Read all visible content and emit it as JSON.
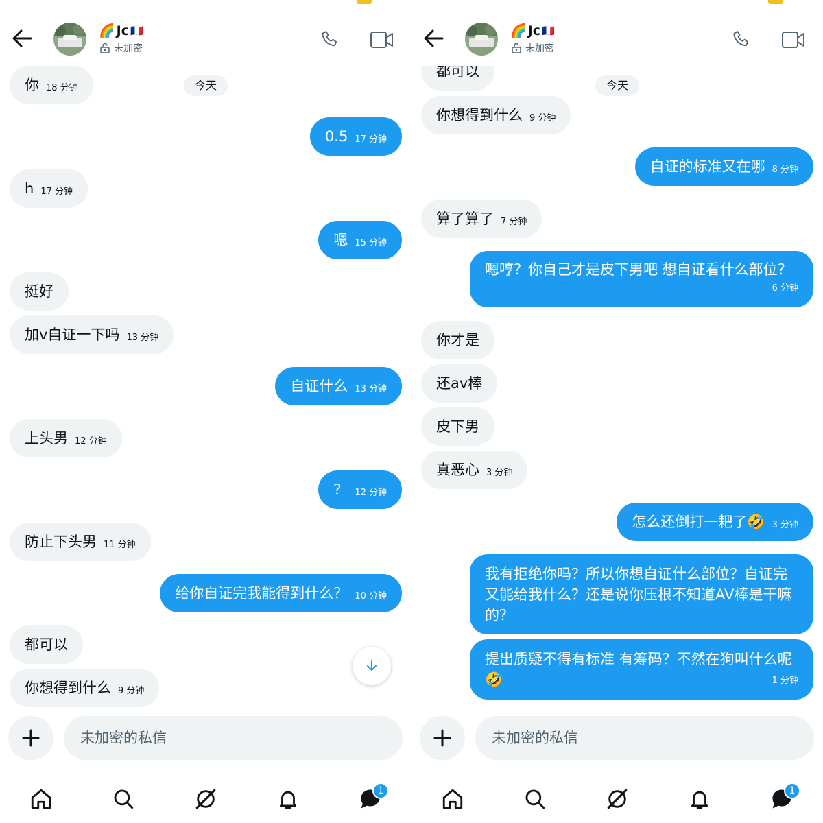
{
  "colors": {
    "accent": "#1d9bf0",
    "incoming_bg": "#eff3f4",
    "text": "#0f1419",
    "muted": "#536471"
  },
  "left": {
    "header": {
      "name": "Jc",
      "emoji_prefix": "🌈",
      "emoji_suffix": "🇫🇷",
      "encryption_status": "未加密"
    },
    "date_label": "今天",
    "messages": [
      {
        "dir": "in",
        "text": "你",
        "time": "18 分钟"
      },
      {
        "dir": "out",
        "text": "0.5",
        "time": "17 分钟"
      },
      {
        "dir": "in",
        "text": "h",
        "time": "17 分钟"
      },
      {
        "dir": "out",
        "text": "嗯",
        "time": "15 分钟"
      },
      {
        "dir": "in",
        "text": "挺好",
        "time": ""
      },
      {
        "dir": "in",
        "text": "加v自证一下吗",
        "time": "13 分钟"
      },
      {
        "dir": "out",
        "text": "自证什么",
        "time": "13 分钟"
      },
      {
        "dir": "in",
        "text": "上头男",
        "time": "12 分钟"
      },
      {
        "dir": "out",
        "text": "？",
        "time": "12 分钟"
      },
      {
        "dir": "in",
        "text": "防止下头男",
        "time": "11 分钟"
      },
      {
        "dir": "out",
        "text": "给你自证完我能得到什么？",
        "time": "10 分钟"
      },
      {
        "dir": "in",
        "text": "都可以",
        "time": ""
      },
      {
        "dir": "in",
        "text": "你想得到什么",
        "time": "9 分钟"
      }
    ],
    "composer": {
      "placeholder": "未加密的私信"
    },
    "nav": {
      "messages_badge": "1"
    }
  },
  "right": {
    "header": {
      "name": "Jc",
      "emoji_prefix": "🌈",
      "emoji_suffix": "🇫🇷",
      "encryption_status": "未加密"
    },
    "date_label": "今天",
    "messages": [
      {
        "dir": "in",
        "text": "都可以",
        "time": ""
      },
      {
        "dir": "in",
        "text": "你想得到什么",
        "time": "9 分钟"
      },
      {
        "dir": "out",
        "text": "自证的标准又在哪",
        "time": "8 分钟"
      },
      {
        "dir": "in",
        "text": "算了算了",
        "time": "7 分钟"
      },
      {
        "dir": "out",
        "text": "嗯哼？你自己才是皮下男吧 想自证看什么部位？",
        "time": "6 分钟"
      },
      {
        "dir": "in",
        "text": "你才是",
        "time": ""
      },
      {
        "dir": "in",
        "text": "还av棒",
        "time": ""
      },
      {
        "dir": "in",
        "text": "皮下男",
        "time": ""
      },
      {
        "dir": "in",
        "text": "真恶心",
        "time": "3 分钟"
      },
      {
        "dir": "out",
        "text": "怎么还倒打一耙了🤣",
        "time": "3 分钟"
      },
      {
        "dir": "out",
        "text": "我有拒绝你吗？所以你想自证什么部位？自证完又能给我什么？还是说你压根不知道AV棒是干嘛的？",
        "time": ""
      },
      {
        "dir": "out",
        "text": "提出质疑不得有标准 有筹码？不然在狗叫什么呢🤣",
        "time": "1 分钟"
      }
    ],
    "composer": {
      "placeholder": "未加密的私信"
    },
    "nav": {
      "messages_badge": "1"
    }
  }
}
